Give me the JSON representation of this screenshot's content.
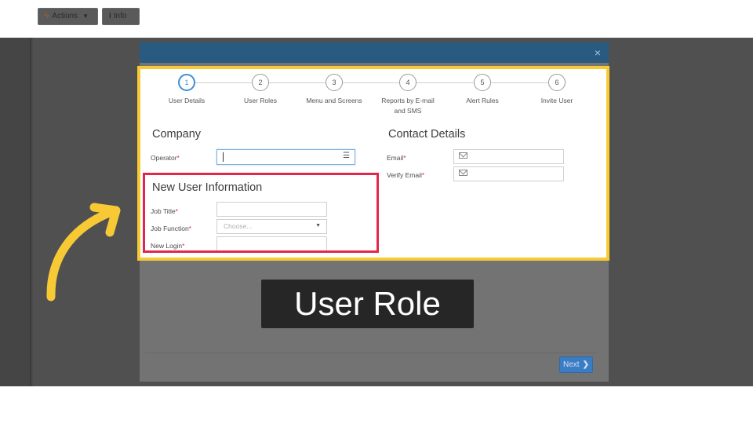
{
  "background": {
    "actions_label": "Actions",
    "info_label": "Info"
  },
  "modal": {
    "close_label": "×",
    "next_label": "Next"
  },
  "steps": [
    {
      "number": "1",
      "label": "User Details"
    },
    {
      "number": "2",
      "label": "User Roles"
    },
    {
      "number": "3",
      "label": "Menu and Screens"
    },
    {
      "number": "4",
      "label": "Reports by E-mail\nand SMS"
    },
    {
      "number": "5",
      "label": "Alert Rules"
    },
    {
      "number": "6",
      "label": "Invite User"
    }
  ],
  "company": {
    "title": "Company",
    "operator_label": "Operator",
    "operator_value": ""
  },
  "contact": {
    "title": "Contact Details",
    "email_label": "Email",
    "verify_email_label": "Verify Email"
  },
  "new_user": {
    "title": "New User Information",
    "job_title_label": "Job Title",
    "job_function_label": "Job Function",
    "job_function_placeholder": "Choose...",
    "new_login_label": "New Login"
  },
  "required_marker": "*",
  "caption": "User Role",
  "colors": {
    "highlight_frame": "#f6c935",
    "focus_box": "#e3264a",
    "arrow": "#f6c935",
    "modal_header": "#295a80",
    "primary_button": "#3b7dc4"
  },
  "icons": {
    "operator_picker": "list-icon",
    "email_field": "envelope-icon",
    "verify_email_field": "envelope-icon",
    "job_function_select": "caret-down-icon",
    "actions_button": "bolt-icon",
    "info_button": "info-icon"
  }
}
